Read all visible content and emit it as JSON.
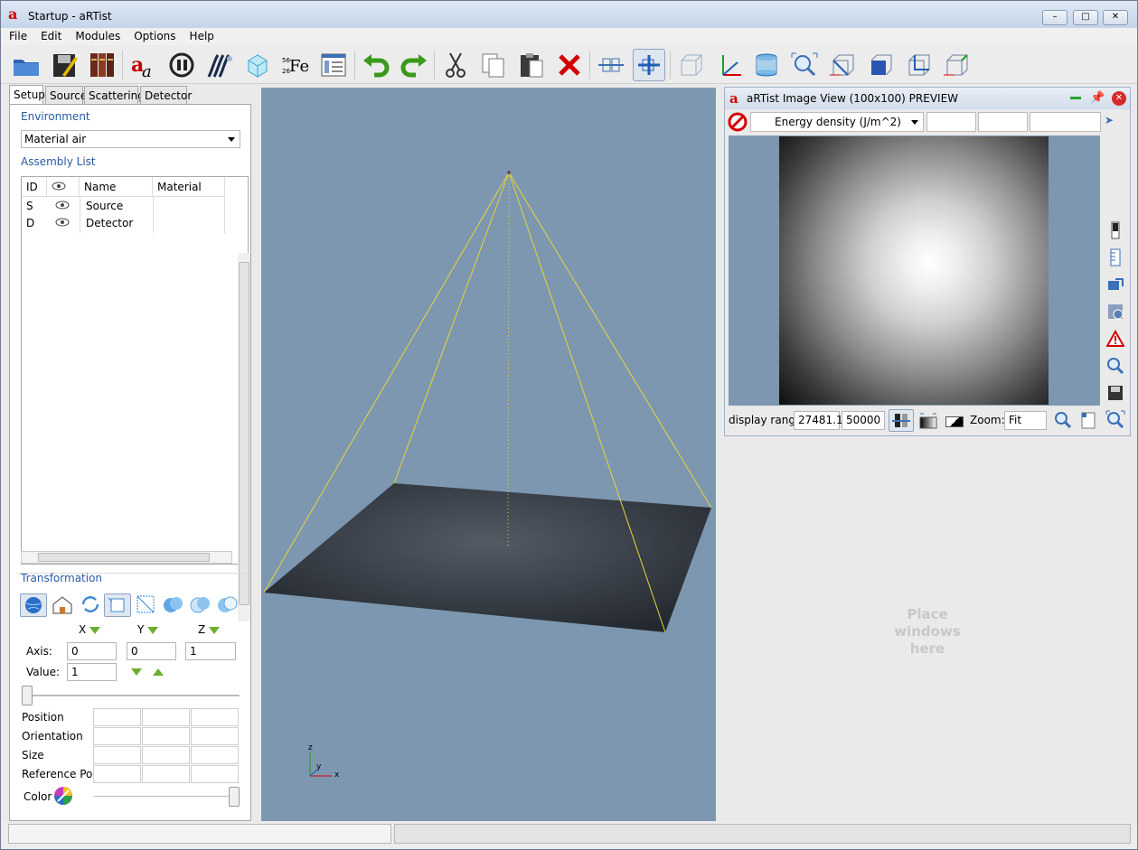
{
  "window": {
    "title": "Startup - aRTist",
    "logo_letter": "a"
  },
  "menu": [
    "File",
    "Edit",
    "Modules",
    "Options",
    "Help"
  ],
  "toolbar": {
    "icons": [
      "open-folder-icon",
      "save-icon",
      "library-icon",
      "text-aa-icon",
      "pause-icon",
      "wave-icon",
      "crystal-icon",
      "element-fe-icon",
      "panel-icon",
      "undo-icon",
      "redo-icon",
      "cut-icon",
      "copy-icon",
      "paste-icon",
      "delete-icon",
      "align-icon",
      "select-icon",
      "box-wireframe-icon",
      "axes-icon",
      "cylinder-icon",
      "zoom-fit-icon",
      "view-front-icon",
      "view-side-icon",
      "view-top-icon",
      "view-iso-icon"
    ],
    "fe_label": "Fe",
    "fe_top": "56",
    "fe_bottom": "26"
  },
  "tabs": [
    "Setup",
    "Source",
    "Scattering",
    "Detector"
  ],
  "environment": {
    "heading": "Environment",
    "material_label": "Material",
    "material_value": "air"
  },
  "assembly": {
    "heading": "Assembly List",
    "columns": [
      "ID",
      "",
      "Name",
      "Material"
    ],
    "rows": [
      {
        "id": "S",
        "name": "Source",
        "material": ""
      },
      {
        "id": "D",
        "name": "Detector",
        "material": ""
      }
    ]
  },
  "transformation": {
    "heading": "Transformation",
    "axis_x": "X",
    "axis_y": "Y",
    "axis_z": "Z",
    "axis_label": "Axis:",
    "axis_values": [
      "0",
      "0",
      "1"
    ],
    "value_label": "Value:",
    "value": "1",
    "position_label": "Position",
    "orientation_label": "Orientation",
    "size_label": "Size",
    "refpos_label": "Reference Pos.",
    "color_label": "Color"
  },
  "viewport": {
    "axis_z": "z",
    "axis_y": "y",
    "axis_x": "x",
    "background": "#7e97b0",
    "ray_color": "#e6d43a"
  },
  "image_view": {
    "title": "aRTist Image View (100x100) PREVIEW",
    "quantity": "Energy density (J/m^2)",
    "display_range_label": "display range",
    "range_min": "27481.1",
    "range_max": "50000",
    "zoom_label": "Zoom:",
    "zoom_value": "Fit"
  },
  "placeholder": {
    "text": "Place windows here"
  }
}
